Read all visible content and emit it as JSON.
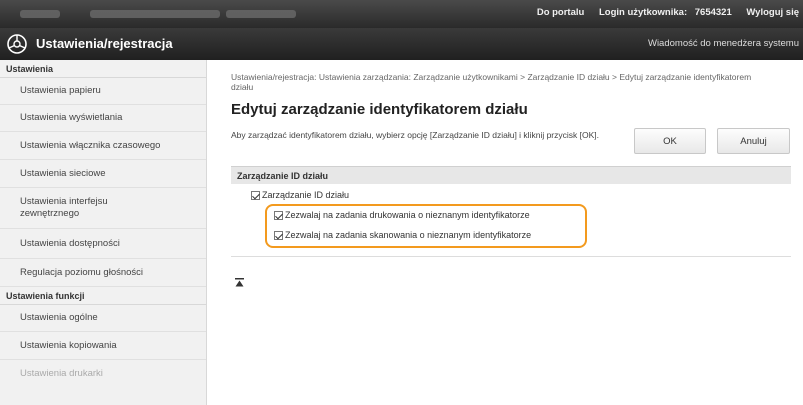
{
  "topbar": {
    "links": [
      "Do portalu",
      "Login użytkownika:",
      "7654321",
      "Wyloguj się"
    ]
  },
  "titlebar": {
    "title": "Ustawienia/rejestracja",
    "message_link": "Wiadomość do menedżera systemu",
    "logo_icon": "settings-registration-icon"
  },
  "sidebar": {
    "group1": "Ustawienia",
    "items1": [
      "Ustawienia papieru",
      "Ustawienia wyświetlania",
      "Ustawienia włącznika czasowego",
      "Ustawienia sieciowe",
      "Ustawienia interfejsu zewnętrznego",
      "Ustawienia dostępności",
      "Regulacja poziomu głośności"
    ],
    "group2": "Ustawienia funkcji",
    "items2": [
      "Ustawienia ogólne",
      "Ustawienia kopiowania",
      "Ustawienia drukarki"
    ]
  },
  "main": {
    "breadcrumb": "Ustawienia/rejestracja: Ustawienia zarządzania: Zarządzanie użytkownikami > Zarządzanie ID działu > Edytuj zarządzanie identyfikatorem działu",
    "title": "Edytuj zarządzanie identyfikatorem działu",
    "description": "Aby zarządzać identyfikatorem działu, wybierz opcję [Zarządzanie ID działu] i kliknij przycisk [OK].",
    "ok_label": "OK",
    "cancel_label": "Anuluj",
    "section_title": "Zarządzanie ID działu",
    "checkbox_main": "Zarządzanie ID działu",
    "checkbox_print": "Zezwalaj na zadania drukowania o nieznanym identyfikatorze",
    "checkbox_scan": "Zezwalaj na zadania skanowania o nieznanym identyfikatorze",
    "highlight_color": "#f39a1e",
    "to_top_icon": "back-to-top-icon"
  }
}
